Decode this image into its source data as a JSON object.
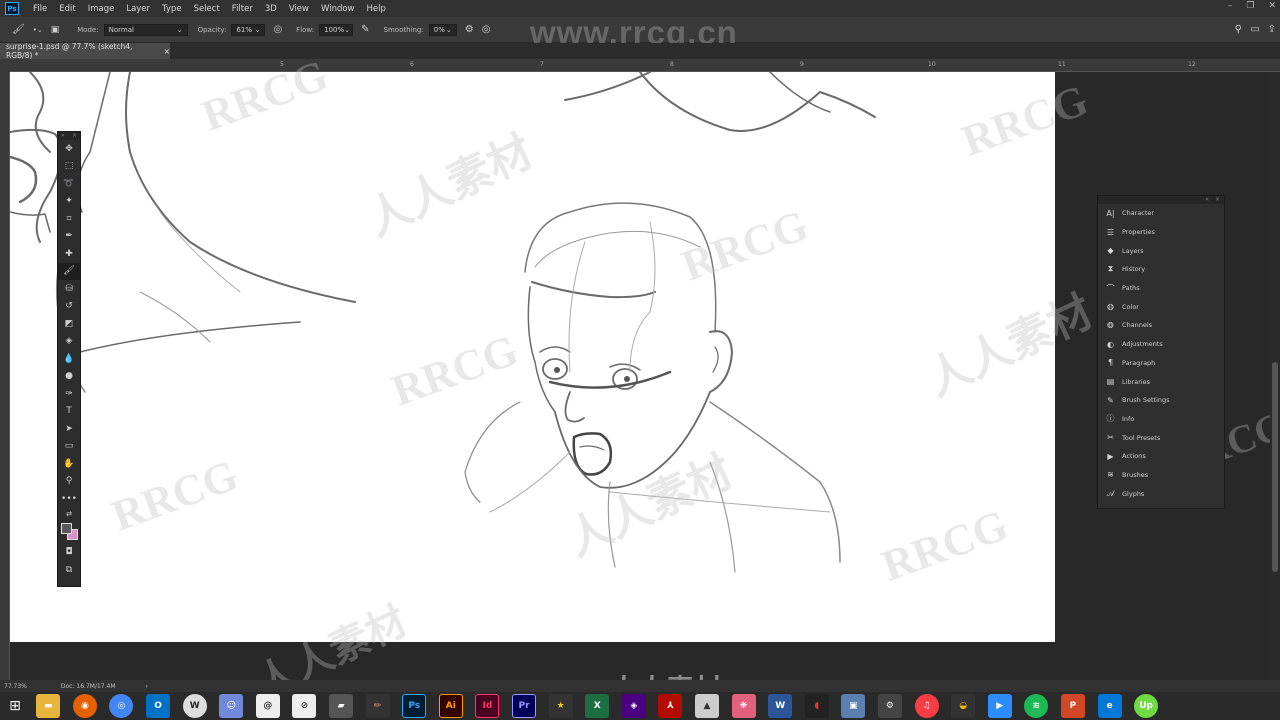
{
  "app": {
    "logo_text": "Ps"
  },
  "menu": [
    "File",
    "Edit",
    "Image",
    "Layer",
    "Type",
    "Select",
    "Filter",
    "3D",
    "View",
    "Window",
    "Help"
  ],
  "options": {
    "mode_label": "Mode:",
    "mode_value": "Normal",
    "opacity_label": "Opacity:",
    "opacity_value": "61%",
    "flow_label": "Flow:",
    "flow_value": "100%",
    "smoothing_label": "Smoothing:",
    "smoothing_value": "0%"
  },
  "watermark": {
    "url": "www.rrcg.cn",
    "text": "RRCG",
    "cn": "人人素材"
  },
  "document": {
    "tab_title": "surprise-1.psd @ 77.7% (sketch4, RGB/8) *",
    "close": "×"
  },
  "rulers": {
    "top": [
      "5",
      "6",
      "7",
      "8",
      "9",
      "10",
      "11",
      "12"
    ]
  },
  "panels": [
    {
      "label": "Character",
      "icon": "character-icon"
    },
    {
      "label": "Properties",
      "icon": "properties-icon"
    },
    {
      "label": "Layers",
      "icon": "layers-icon"
    },
    {
      "label": "History",
      "icon": "history-icon"
    },
    {
      "label": "Paths",
      "icon": "paths-icon"
    },
    {
      "label": "Color",
      "icon": "color-icon"
    },
    {
      "label": "Channels",
      "icon": "channels-icon"
    },
    {
      "label": "Adjustments",
      "icon": "adjustments-icon"
    },
    {
      "label": "Paragraph",
      "icon": "paragraph-icon"
    },
    {
      "label": "Libraries",
      "icon": "libraries-icon"
    },
    {
      "label": "Brush Settings",
      "icon": "brush-settings-icon"
    },
    {
      "label": "Info",
      "icon": "info-icon"
    },
    {
      "label": "Tool Presets",
      "icon": "tool-presets-icon"
    },
    {
      "label": "Actions",
      "icon": "actions-icon"
    },
    {
      "label": "Brushes",
      "icon": "brushes-icon"
    },
    {
      "label": "Glyphs",
      "icon": "glyphs-icon"
    }
  ],
  "status": {
    "zoom": "77.73%",
    "doc": "Doc: 16.7M/17.4M"
  },
  "taskbar": [
    "Ai",
    "Id",
    "Pr"
  ]
}
